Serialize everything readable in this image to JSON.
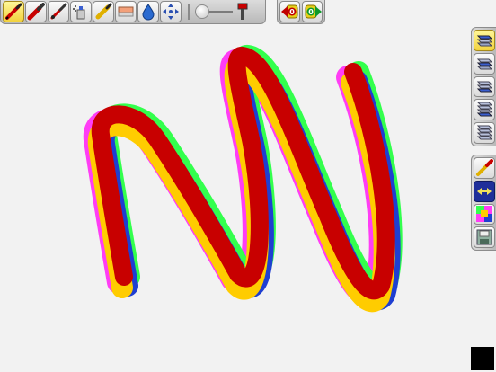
{
  "toolbar": {
    "tools": [
      {
        "icon": "pen-icon",
        "active": true
      },
      {
        "icon": "marker-icon",
        "active": false
      },
      {
        "icon": "brush-icon",
        "active": false
      },
      {
        "icon": "spray-can-icon",
        "active": false
      },
      {
        "icon": "paintbrush-icon",
        "active": false
      },
      {
        "icon": "eraser-icon",
        "active": false
      },
      {
        "icon": "drop-icon",
        "active": false
      },
      {
        "icon": "move-arrows-icon",
        "active": false
      }
    ],
    "brush_size_level": 0.0
  },
  "undo_redo": {
    "undo_count": "0",
    "redo_count": "0"
  },
  "layers": {
    "count": 5,
    "active_index": 0
  },
  "side_tools": [
    {
      "icon": "color-picker-icon"
    },
    {
      "icon": "flip-horizontal-icon"
    },
    {
      "icon": "color-palette-icon"
    },
    {
      "icon": "save-icon"
    }
  ],
  "current_color": "#000000",
  "stroke_colors": [
    "#ff3df5",
    "#33ff4d",
    "#1f3fd1",
    "#ffcc00",
    "#c80000"
  ]
}
